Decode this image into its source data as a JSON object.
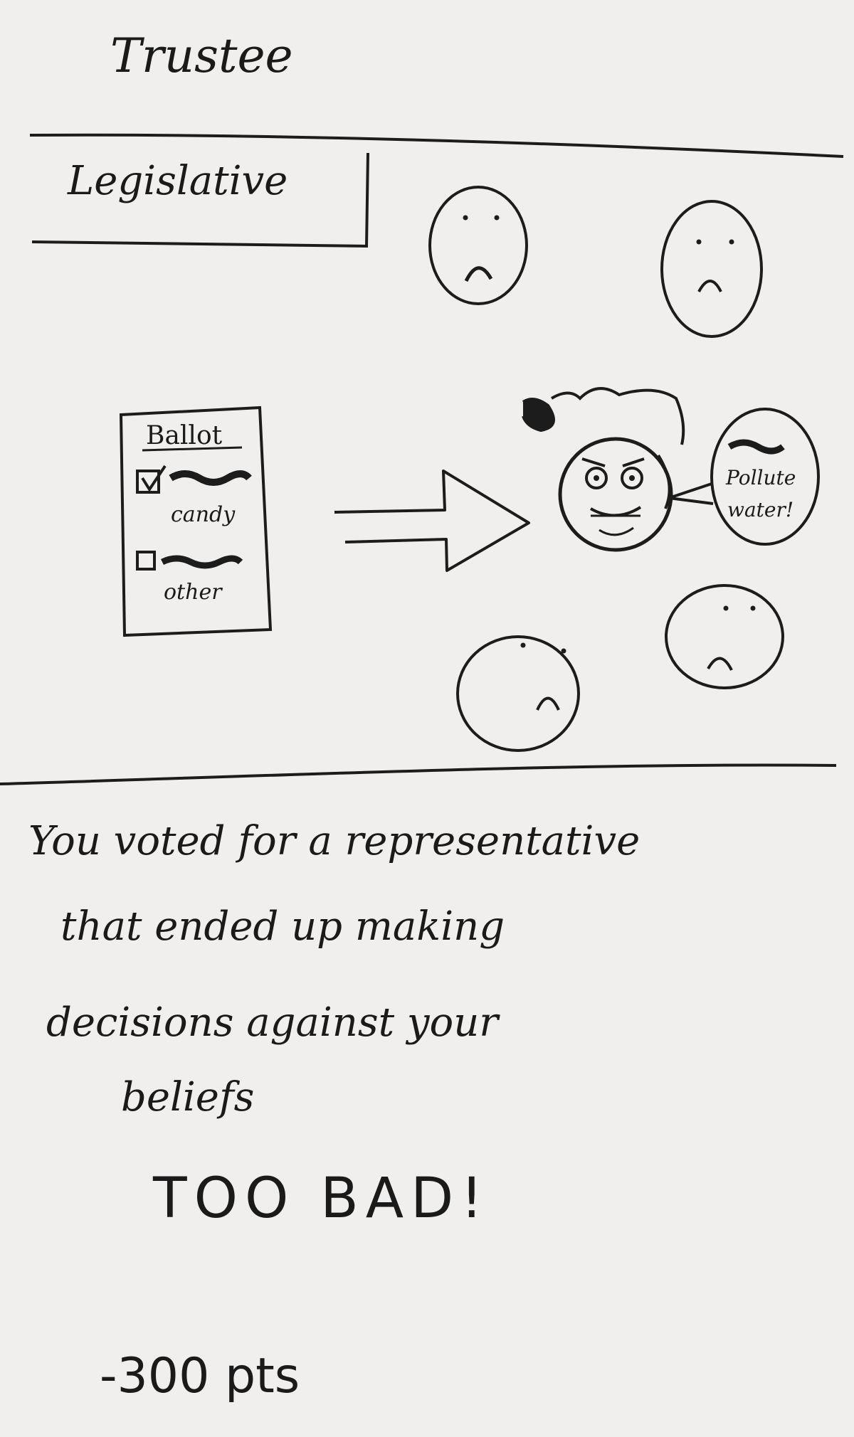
{
  "header": {
    "title": "Trustee"
  },
  "section": {
    "title": "Legislative"
  },
  "ballot": {
    "title": "Ballot",
    "options": [
      {
        "label": "candy",
        "checked": true
      },
      {
        "label": "other",
        "checked": false
      }
    ]
  },
  "speech_bubble": {
    "text_line1": "Pollute",
    "text_line2": "water!"
  },
  "message": {
    "line1": "You voted for a representative",
    "line2": "that ended up making",
    "line3": "decisions against your",
    "line4": "beliefs"
  },
  "outcome": "TOO BAD!",
  "points": "-300 pts",
  "colors": {
    "ink": "#1c1c1c",
    "paper": "#f0efed"
  },
  "icons": [
    "sad-face-icon",
    "angry-face-icon",
    "right-arrow-icon",
    "checkbox-icon"
  ]
}
